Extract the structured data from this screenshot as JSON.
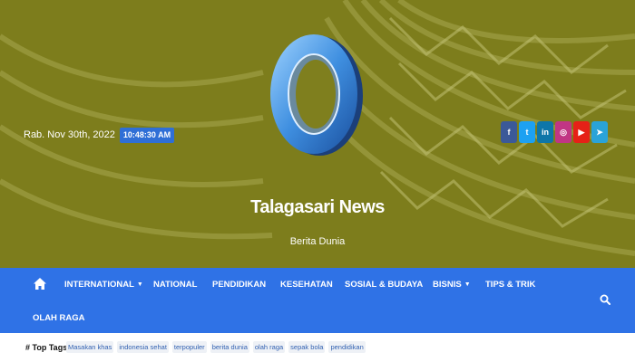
{
  "header": {
    "date": "Rab. Nov 30th, 2022",
    "time": "10:48:30 AM",
    "site_title": "Talagasari News",
    "tagline": "Berita Dunia",
    "socials": [
      {
        "icon": "facebook-icon",
        "glyph": "f",
        "color": "#3b5998"
      },
      {
        "icon": "twitter-icon",
        "glyph": "t",
        "color": "#1da1f2"
      },
      {
        "icon": "linkedin-icon",
        "glyph": "in",
        "color": "#0e76a8"
      },
      {
        "icon": "instagram-icon",
        "glyph": "◎",
        "color": "#c13584"
      },
      {
        "icon": "youtube-icon",
        "glyph": "▶",
        "color": "#e62117"
      },
      {
        "icon": "telegram-icon",
        "glyph": "➤",
        "color": "#2aa3d8"
      }
    ]
  },
  "nav": {
    "home_icon": "home-icon",
    "items": [
      {
        "label": "INTERNATIONAL",
        "dropdown": true
      },
      {
        "label": "NATIONAL",
        "dropdown": false
      },
      {
        "label": "PENDIDIKAN",
        "dropdown": false
      },
      {
        "label": "KESEHATAN",
        "dropdown": false
      },
      {
        "label": "SOSIAL & BUDAYA",
        "dropdown": false
      },
      {
        "label": "BISNIS",
        "dropdown": true
      },
      {
        "label": "TIPS & TRIK",
        "dropdown": false
      },
      {
        "label": "OLAH RAGA",
        "dropdown": false
      }
    ],
    "search_icon": "search-icon"
  },
  "tags": {
    "label": "Top Tags",
    "items": [
      "Masakan khas",
      "indonesia sehat",
      "terpopuler",
      "berita dunia",
      "olah raga",
      "sepak bola",
      "pendidikan"
    ]
  },
  "colors": {
    "header_bg": "#7f7f1e",
    "nav_bg": "#2f72e6",
    "time_badge": "#2f6fd6"
  }
}
